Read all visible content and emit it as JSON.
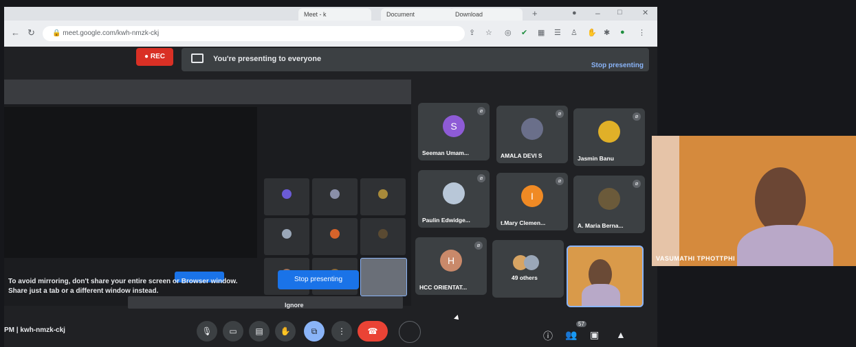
{
  "browser": {
    "url": "meet.google.com/kwh-nmzk-ckj",
    "tabs": [
      "Meet - k",
      "Document",
      "Download"
    ],
    "extension_icons": [
      "share-icon",
      "star-icon",
      "circle-icon",
      "check-icon",
      "grid-icon",
      "list-icon",
      "user-icon",
      "hand-icon",
      "puzzle-icon",
      "avatar-icon"
    ]
  },
  "meet": {
    "rec_label": "REC",
    "banner": {
      "text": "You're presenting to everyone",
      "stop_label": "Stop presenting"
    },
    "mirror": {
      "warning_line1": "To avoid mirroring, don't share your entire screen or Browser window.",
      "warning_line2": "Share just a tab or a different window instead.",
      "stop_button": "Stop presenting",
      "ignore_label": "Ignore"
    },
    "participants": [
      {
        "name": "Seeman Umam...",
        "initial": "S",
        "color": "#8e5bd6"
      },
      {
        "name": "AMALA DEVI S",
        "initial": "",
        "color": "#6a6f8a"
      },
      {
        "name": "Jasmin Banu",
        "initial": "",
        "color": "#e0b028"
      },
      {
        "name": "Paulin Edwidge...",
        "initial": "",
        "color": "#b8c7d8"
      },
      {
        "name": "t.Mary Clemen...",
        "initial": "I",
        "color": "#f08a24"
      },
      {
        "name": "A. Maria Berna...",
        "initial": "",
        "color": "#6b5a3a"
      },
      {
        "name": "HCC ORIENTAT...",
        "initial": "H",
        "color": "#c9896a"
      },
      {
        "name": "49 others",
        "initial": "",
        "color": "#d7a463"
      }
    ],
    "toolbar": {
      "meeting_info": "PM | kwh-nmzk-ckj",
      "buttons": [
        "mic-icon",
        "camera-icon",
        "captions-icon",
        "raise-hand-icon",
        "present-icon",
        "more-icon",
        "end-call-icon",
        "ring-icon"
      ],
      "right_icons": [
        "info-icon",
        "people-icon",
        "chat-icon",
        "activities-icon"
      ],
      "people_badge": "57"
    }
  },
  "side_video": {
    "name": "VASUMATHI TPHOTTPHI"
  }
}
